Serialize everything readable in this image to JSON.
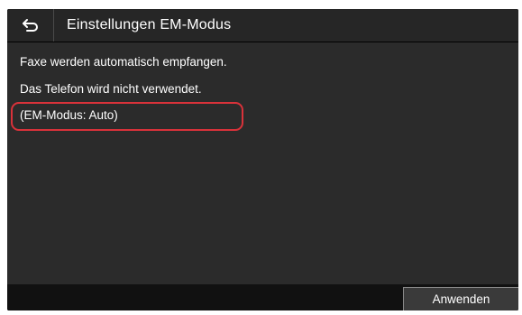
{
  "header": {
    "back_icon": "back-arrow-icon",
    "title": "Einstellungen EM-Modus"
  },
  "content": {
    "lines": [
      "Faxe werden automatisch empfangen.",
      "Das Telefon wird nicht verwendet.",
      "(EM-Modus: Auto)"
    ],
    "highlight_color": "#d9323a"
  },
  "footer": {
    "apply_label": "Anwenden"
  },
  "colors": {
    "background": "#2b2b2b",
    "titlebar": "#262626",
    "text": "#ffffff"
  }
}
